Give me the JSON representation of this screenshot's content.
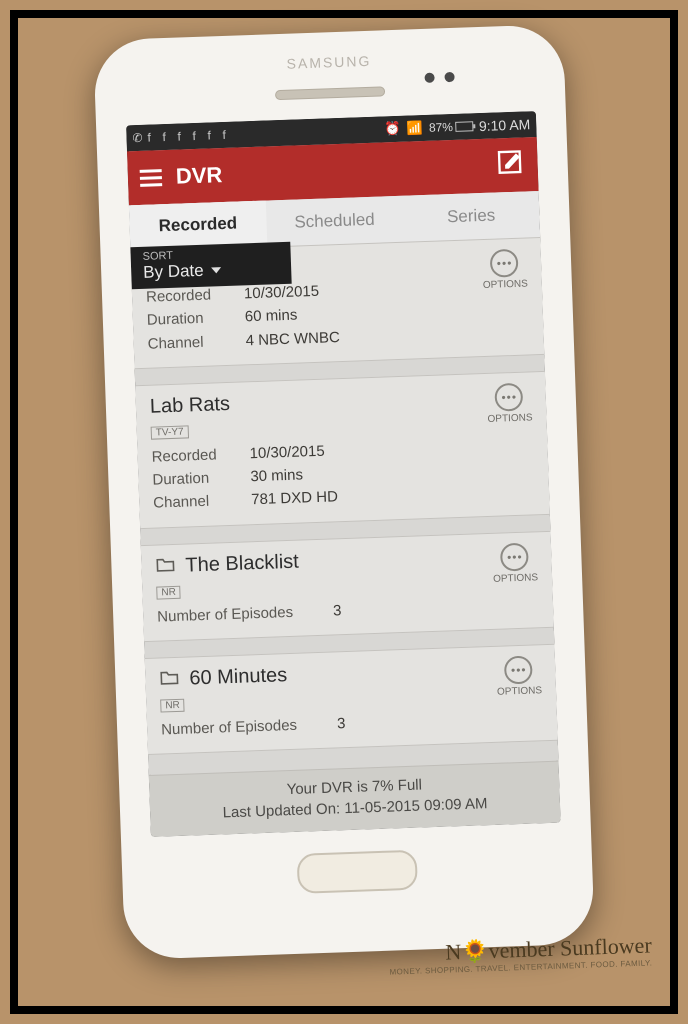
{
  "status": {
    "battery_text": "87%",
    "battery_pct": 87,
    "time": "9:10 AM"
  },
  "appbar": {
    "title": "DVR"
  },
  "tabs": [
    {
      "label": "Recorded",
      "active": true
    },
    {
      "label": "Scheduled",
      "active": false
    },
    {
      "label": "Series",
      "active": false
    }
  ],
  "sort": {
    "label": "SORT",
    "value": "By Date"
  },
  "items": [
    {
      "title": "",
      "rating": "",
      "recorded_label": "Recorded",
      "recorded": "10/30/2015",
      "duration_label": "Duration",
      "duration": "60 mins",
      "channel_label": "Channel",
      "channel": "4 NBC WNBC",
      "options_label": "OPTIONS"
    },
    {
      "title": "Lab Rats",
      "rating": "TV-Y7",
      "recorded_label": "Recorded",
      "recorded": "10/30/2015",
      "duration_label": "Duration",
      "duration": "30 mins",
      "channel_label": "Channel",
      "channel": "781 DXD HD",
      "options_label": "OPTIONS"
    },
    {
      "title": "The Blacklist",
      "rating": "NR",
      "episodes_label": "Number of Episodes",
      "episodes": "3",
      "options_label": "OPTIONS",
      "folder": true
    },
    {
      "title": "60 Minutes",
      "rating": "NR",
      "episodes_label": "Number of Episodes",
      "episodes": "3",
      "options_label": "OPTIONS",
      "folder": true
    }
  ],
  "footer": {
    "line1": "Your DVR is 7% Full",
    "line2": "Last Updated On: 11-05-2015 09:09 AM"
  },
  "watermark": {
    "title": "N🌻vember Sunflower",
    "subtitle": "MONEY. SHOPPING. TRAVEL. ENTERTAINMENT. FOOD. FAMILY."
  }
}
